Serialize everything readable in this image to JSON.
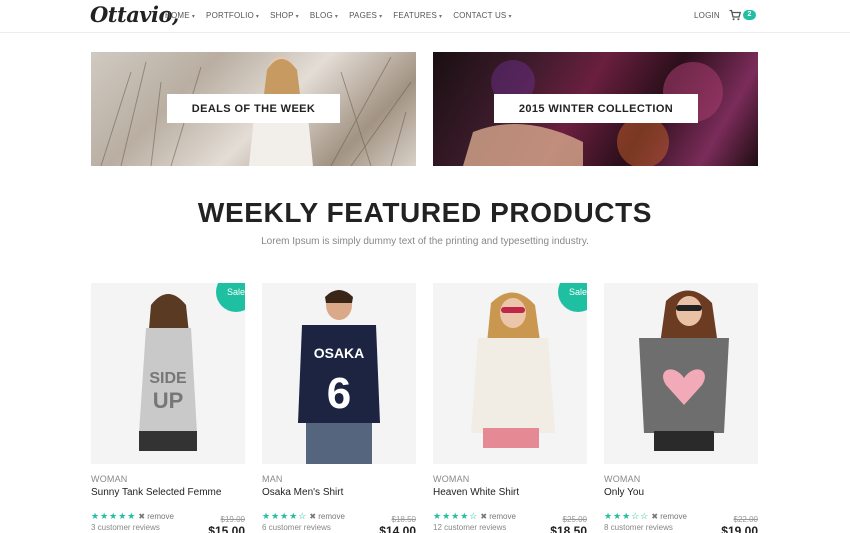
{
  "header": {
    "logo": "Ottavio,",
    "nav": [
      "HOME",
      "PORTFOLIO",
      "SHOP",
      "BLOG",
      "PAGES",
      "FEATURES",
      "CONTACT US"
    ],
    "login": "LOGIN",
    "cart_count": "2"
  },
  "banners": [
    {
      "label": "DEALS OF THE WEEK"
    },
    {
      "label": "2015 WINTER COLLECTION"
    }
  ],
  "section": {
    "title": "WEEKLY FEATURED PRODUCTS",
    "subtitle": "Lorem Ipsum is simply dummy text of the printing and typesetting industry."
  },
  "products": [
    {
      "category": "WOMAN",
      "name": "Sunny Tank Selected Femme",
      "stars": "★★★★★",
      "remove": "✖ remove",
      "reviews": "3 customer reviews",
      "old_price": "$19.00",
      "price": "$15.00",
      "sale": "Sale"
    },
    {
      "category": "MAN",
      "name": "Osaka Men's Shirt",
      "stars": "★★★★☆",
      "remove": "✖ remove",
      "reviews": "6 customer reviews",
      "old_price": "$18.50",
      "price": "$14.00",
      "sale": ""
    },
    {
      "category": "WOMAN",
      "name": "Heaven White Shirt",
      "stars": "★★★★☆",
      "remove": "✖ remove",
      "reviews": "12 customer reviews",
      "old_price": "$25.00",
      "price": "$18.50",
      "sale": "Sale"
    },
    {
      "category": "WOMAN",
      "name": "Only You",
      "stars": "★★★☆☆",
      "remove": "✖ remove",
      "reviews": "8 customer reviews",
      "old_price": "$22.00",
      "price": "$19.00",
      "sale": ""
    }
  ],
  "colors": {
    "accent": "#1fbfa1"
  },
  "icons": {
    "cart": "cart-icon",
    "caret": "chevron-down-icon"
  }
}
